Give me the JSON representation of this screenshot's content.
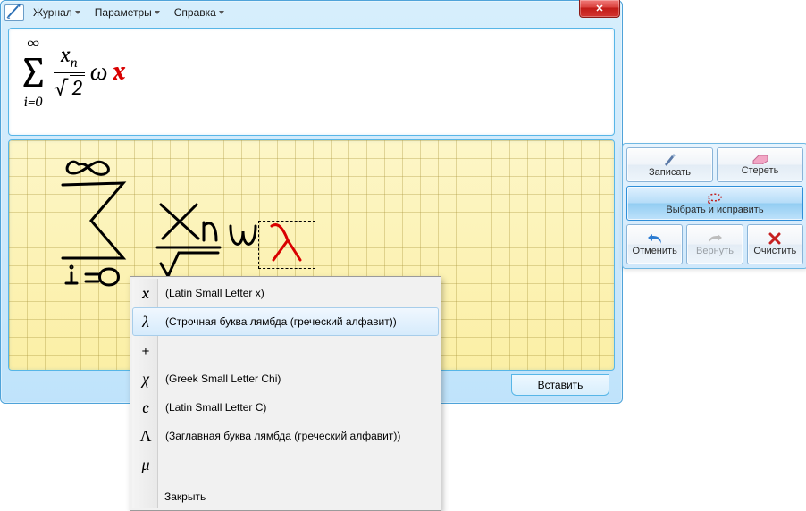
{
  "menu": {
    "journal": "Журнал",
    "parameters": "Параметры",
    "help": "Справка"
  },
  "formula": {
    "sum_upper": "∞",
    "sum_lower": "i=0",
    "frac_num": "xₙ",
    "frac_den_root": "√",
    "frac_den_val": "2",
    "omega": "ω",
    "selected": "x"
  },
  "insert_label": "Вставить",
  "toolbox": {
    "write": "Записать",
    "erase": "Стереть",
    "select_correct": "Выбрать и исправить",
    "undo": "Отменить",
    "redo": "Вернуть",
    "clear": "Очистить"
  },
  "context": {
    "items": [
      {
        "sym": "x",
        "desc": "(Latin Small Letter x)"
      },
      {
        "sym": "λ",
        "desc": "(Строчная буква лямбда (греческий алфавит))"
      },
      {
        "sym": "+",
        "desc": ""
      },
      {
        "sym": "χ",
        "desc": "(Greek Small Letter Chi)"
      },
      {
        "sym": "c",
        "desc": "(Latin Small Letter C)"
      },
      {
        "sym": "Λ",
        "desc": "(Заглавная буква лямбда (греческий алфавит))"
      },
      {
        "sym": "μ",
        "desc": ""
      }
    ],
    "close": "Закрыть"
  }
}
